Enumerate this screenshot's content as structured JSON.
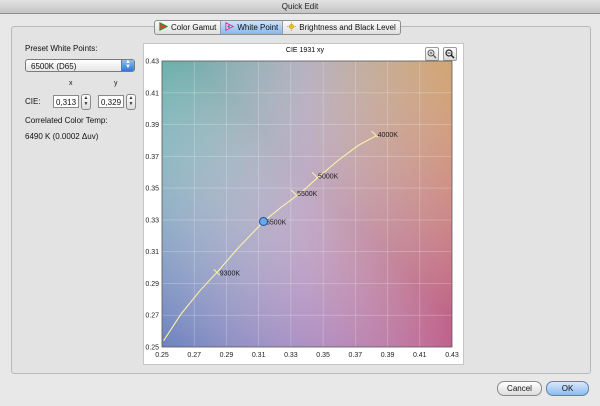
{
  "window": {
    "title": "Quick Edit"
  },
  "tabs": [
    {
      "label": "Color Gamut",
      "icon": "color-gamut-icon",
      "selected": false
    },
    {
      "label": "White Point",
      "icon": "white-point-icon",
      "selected": true
    },
    {
      "label": "Brightness and Black Level",
      "icon": "sun-icon",
      "selected": false
    }
  ],
  "left_panel": {
    "preset_label": "Preset White Points:",
    "preset_value": "6500K (D65)",
    "x_header": "x",
    "y_header": "y",
    "cie_label": "CIE:",
    "cie_x": "0,313",
    "cie_y": "0,329",
    "cct_label": "Correlated Color Temp:",
    "cct_value": "6490 K (0.0002 Δuv)"
  },
  "buttons": {
    "cancel": "Cancel",
    "ok": "OK"
  },
  "chart_data": {
    "type": "scatter",
    "title": "CIE 1931 xy",
    "xlabel": "",
    "ylabel": "",
    "xlim": [
      0.25,
      0.43
    ],
    "ylim": [
      0.25,
      0.43
    ],
    "x_ticks": [
      "0.25",
      "0.27",
      "0.29",
      "0.31",
      "0.33",
      "0.35",
      "0.37",
      "0.39",
      "0.41",
      "0.43"
    ],
    "y_ticks": [
      "0.25",
      "0.27",
      "0.29",
      "0.31",
      "0.33",
      "0.35",
      "0.37",
      "0.39",
      "0.41",
      "0.43"
    ],
    "grid": true,
    "planckian_locus": {
      "x": [
        0.251,
        0.262,
        0.274,
        0.285,
        0.297,
        0.313,
        0.324,
        0.336,
        0.346,
        0.36,
        0.372,
        0.383
      ],
      "y": [
        0.254,
        0.271,
        0.286,
        0.298,
        0.312,
        0.329,
        0.338,
        0.347,
        0.356,
        0.368,
        0.377,
        0.383
      ]
    },
    "temperature_marks": [
      {
        "label": "9300K",
        "x": 0.284,
        "y": 0.297
      },
      {
        "label": "6500K",
        "x": 0.3127,
        "y": 0.329
      },
      {
        "label": "5500K",
        "x": 0.332,
        "y": 0.347
      },
      {
        "label": "5000K",
        "x": 0.345,
        "y": 0.358
      },
      {
        "label": "4000K",
        "x": 0.382,
        "y": 0.384
      }
    ],
    "white_point": {
      "x": 0.313,
      "y": 0.329
    }
  }
}
